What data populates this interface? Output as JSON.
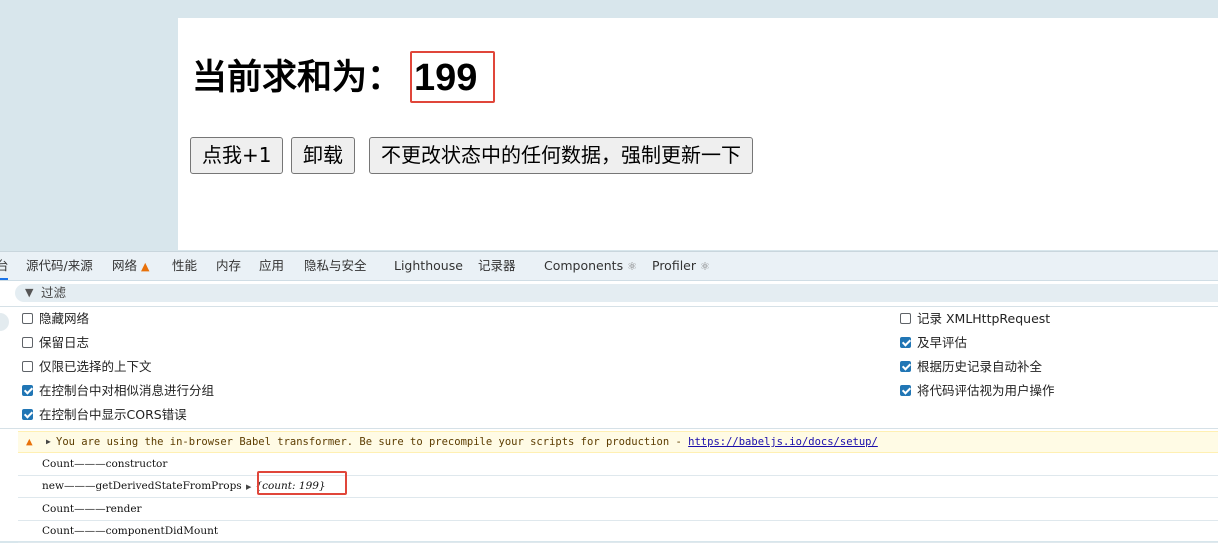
{
  "page": {
    "title_prefix": "当前求和为：",
    "count_value": "199",
    "buttons": {
      "increment": "点我+1",
      "unmount": "卸载",
      "force_update": "不更改状态中的任何数据，强制更新一下"
    }
  },
  "devtools": {
    "tabs": {
      "console_fragment": "台",
      "sources": "源代码/来源",
      "network": "网络",
      "performance": "性能",
      "memory": "内存",
      "application": "应用",
      "privacy_security": "隐私与安全",
      "lighthouse": "Lighthouse",
      "recorder": "记录器",
      "components": "Components",
      "profiler": "Profiler"
    },
    "filter_placeholder": "过滤",
    "settings_left": [
      {
        "label": "隐藏网络",
        "checked": false
      },
      {
        "label": "保留日志",
        "checked": false
      },
      {
        "label": "仅限已选择的上下文",
        "checked": false
      },
      {
        "label": "在控制台中对相似消息进行分组",
        "checked": true
      },
      {
        "label": "在控制台中显示CORS错误",
        "checked": true
      }
    ],
    "settings_right": [
      {
        "label": "记录 XMLHttpRequest",
        "checked": false
      },
      {
        "label": "及早评估",
        "checked": true
      },
      {
        "label": "根据历史记录自动补全",
        "checked": true
      },
      {
        "label": "将代码评估视为用户操作",
        "checked": true
      }
    ],
    "console": {
      "warning_text": "You are using the in-browser Babel transformer. Be sure to precompile your scripts for production - ",
      "warning_link": "https://babeljs.io/docs/setup/",
      "logs": [
        {
          "text": "Count———constructor"
        },
        {
          "text": "new———getDerivedStateFromProps",
          "object": "{count: 199}"
        },
        {
          "text": "Count———render"
        },
        {
          "text": "Count———componentDidMount"
        }
      ]
    }
  },
  "colors": {
    "highlight_border": "#e0463a",
    "checkbox_checked": "#2176b5",
    "warning_icon": "#e8710a"
  }
}
